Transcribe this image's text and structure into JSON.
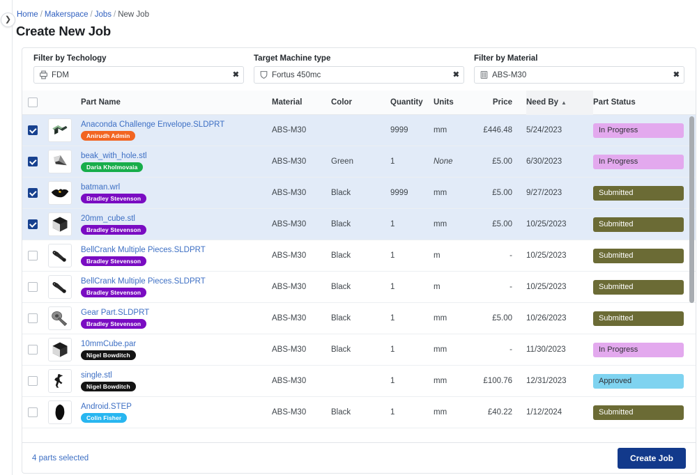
{
  "breadcrumb": {
    "items": [
      "Home",
      "Makerspace",
      "Jobs",
      "New Job"
    ],
    "separator": "/"
  },
  "page_title": "Create New Job",
  "sidebar_toggle_icon": "chevron-right-icon",
  "filters": [
    {
      "label": "Filter by Techology",
      "value": "FDM",
      "icon": "printer-icon",
      "clear": "✖"
    },
    {
      "label": "Target Machine type",
      "value": "Fortus 450mc",
      "icon": "shield-icon",
      "clear": "✖"
    },
    {
      "label": "Filter by Material",
      "value": "ABS-M30",
      "icon": "spool-icon",
      "clear": "✖"
    }
  ],
  "table": {
    "headers": {
      "part_name": "Part Name",
      "material": "Material",
      "color": "Color",
      "quantity": "Quantity",
      "units": "Units",
      "price": "Price",
      "need_by": "Need By",
      "part_status": "Part Status",
      "sort_arrow": "▲"
    },
    "select_all_checked": false,
    "rows": [
      {
        "selected": true,
        "thumb": "green-bracket-icon",
        "name": "Anaconda Challenge Envelope.SLDPRT",
        "owner": "Anirudh Admin",
        "owner_color": "#f26522",
        "material": "ABS-M30",
        "color": "",
        "quantity": "9999",
        "units": "mm",
        "units_italic": false,
        "price": "£446.48",
        "need_by": "5/24/2023",
        "status": "In Progress",
        "status_bg": "#e3a9ee",
        "status_fg": "#2f2f35"
      },
      {
        "selected": true,
        "thumb": "beak-wedge-icon",
        "name": "beak_with_hole.stl",
        "owner": "Daria Kholmovaia",
        "owner_color": "#17ad4a",
        "material": "ABS-M30",
        "color": "Green",
        "quantity": "1",
        "units": "None",
        "units_italic": true,
        "price": "£5.00",
        "need_by": "6/30/2023",
        "status": "In Progress",
        "status_bg": "#e3a9ee",
        "status_fg": "#2f2f35"
      },
      {
        "selected": true,
        "thumb": "batman-icon",
        "name": "batman.wrl",
        "owner": "Bradley Stevenson",
        "owner_color": "#7a0cc2",
        "material": "ABS-M30",
        "color": "Black",
        "quantity": "9999",
        "units": "mm",
        "units_italic": false,
        "price": "£5.00",
        "need_by": "9/27/2023",
        "status": "Submitted",
        "status_bg": "#6b6b35",
        "status_fg": "#ffffff"
      },
      {
        "selected": true,
        "thumb": "cube-icon",
        "name": "20mm_cube.stl",
        "owner": "Bradley Stevenson",
        "owner_color": "#7a0cc2",
        "material": "ABS-M30",
        "color": "Black",
        "quantity": "1",
        "units": "mm",
        "units_italic": false,
        "price": "£5.00",
        "need_by": "10/25/2023",
        "status": "Submitted",
        "status_bg": "#6b6b35",
        "status_fg": "#ffffff"
      },
      {
        "selected": false,
        "thumb": "bellcrank-icon",
        "name": "BellCrank Multiple Pieces.SLDPRT",
        "owner": "Bradley Stevenson",
        "owner_color": "#7a0cc2",
        "material": "ABS-M30",
        "color": "Black",
        "quantity": "1",
        "units": "m",
        "units_italic": false,
        "price": "-",
        "need_by": "10/25/2023",
        "status": "Submitted",
        "status_bg": "#6b6b35",
        "status_fg": "#ffffff"
      },
      {
        "selected": false,
        "thumb": "bellcrank-icon",
        "name": "BellCrank Multiple Pieces.SLDPRT",
        "owner": "Bradley Stevenson",
        "owner_color": "#7a0cc2",
        "material": "ABS-M30",
        "color": "Black",
        "quantity": "1",
        "units": "m",
        "units_italic": false,
        "price": "-",
        "need_by": "10/25/2023",
        "status": "Submitted",
        "status_bg": "#6b6b35",
        "status_fg": "#ffffff"
      },
      {
        "selected": false,
        "thumb": "gear-part-icon",
        "name": "Gear Part.SLDPRT",
        "owner": "Bradley Stevenson",
        "owner_color": "#7a0cc2",
        "material": "ABS-M30",
        "color": "Black",
        "quantity": "1",
        "units": "mm",
        "units_italic": false,
        "price": "£5.00",
        "need_by": "10/26/2023",
        "status": "Submitted",
        "status_bg": "#6b6b35",
        "status_fg": "#ffffff"
      },
      {
        "selected": false,
        "thumb": "cube-icon",
        "name": "10mmCube.par",
        "owner": "Nigel Bowditch",
        "owner_color": "#141414",
        "material": "ABS-M30",
        "color": "Black",
        "quantity": "1",
        "units": "mm",
        "units_italic": false,
        "price": "-",
        "need_by": "11/30/2023",
        "status": "In Progress",
        "status_bg": "#e3a9ee",
        "status_fg": "#2f2f35"
      },
      {
        "selected": false,
        "thumb": "bird-icon",
        "name": "single.stl",
        "owner": "Nigel Bowditch",
        "owner_color": "#141414",
        "material": "ABS-M30",
        "color": "",
        "quantity": "1",
        "units": "mm",
        "units_italic": false,
        "price": "£100.76",
        "need_by": "12/31/2023",
        "status": "Approved",
        "status_bg": "#7fd3f0",
        "status_fg": "#2f2f35"
      },
      {
        "selected": false,
        "thumb": "android-icon",
        "name": "Android.STEP",
        "owner": "Colin Fisher",
        "owner_color": "#28b6f0",
        "material": "ABS-M30",
        "color": "Black",
        "quantity": "1",
        "units": "mm",
        "units_italic": false,
        "price": "£40.22",
        "need_by": "1/12/2024",
        "status": "Submitted",
        "status_bg": "#6b6b35",
        "status_fg": "#ffffff"
      }
    ]
  },
  "footer": {
    "selected_text": "4 parts selected",
    "create_button": "Create Job"
  },
  "colors": {
    "primary": "#12398b",
    "link": "#3d6fc4",
    "selected_row": "#e2ebf8",
    "checkbox": "#17418f"
  }
}
